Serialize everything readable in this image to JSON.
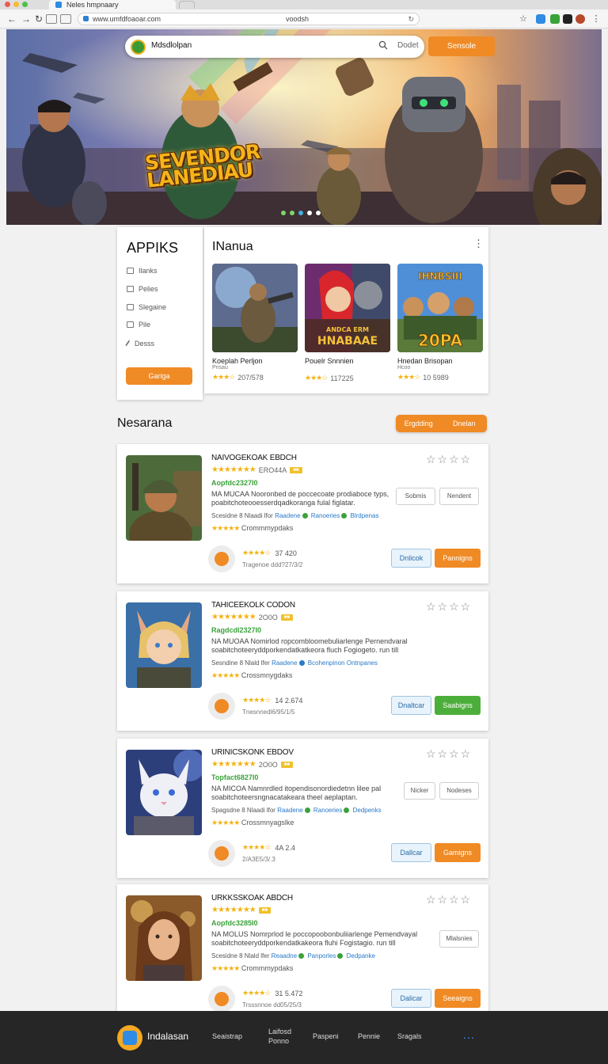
{
  "browser": {
    "tab_title": "Neles hmpnaary",
    "url": "www.umfdfoaoar.com",
    "url_mid": "voodsh",
    "traffic_colors": [
      "#ee5b52",
      "#f5bd2f",
      "#49c249"
    ]
  },
  "hero": {
    "site_name": "Mdsdlolpan",
    "search_placeholder": "Dodet",
    "cta_label": "Sensole",
    "title_line1": "SEVENDOR",
    "title_line2": "LANEDIAU",
    "active_slide": 4,
    "slide_count": 5
  },
  "sidebar": {
    "title": "APPIKS",
    "items": [
      {
        "label": "Ilanks",
        "icon": "tag-icon"
      },
      {
        "label": "Pelies",
        "icon": "image-icon"
      },
      {
        "label": "Slegaine",
        "icon": "box-icon"
      },
      {
        "label": "Pile",
        "icon": "folder-icon"
      },
      {
        "label": "Desss",
        "icon": "pencil-icon"
      }
    ],
    "button_label": "Gariga"
  },
  "featured": {
    "title": "INanua",
    "items": [
      {
        "name": "Koeplah Perljon",
        "sub": "Prisau",
        "stars": 3.5,
        "count": "207/578"
      },
      {
        "name": "Pouelr Snnnien",
        "sub": "",
        "stars": 3.5,
        "count": "117225"
      },
      {
        "name": "Hnedan Brisopan",
        "sub": "Hcoo",
        "stars": 3.5,
        "count": "10 5989"
      }
    ],
    "img_texts": [
      "",
      "ANDCA ERM\nHNABAAE",
      "IHNBSIII\n20PA"
    ]
  },
  "section": {
    "title": "Nesarana",
    "toggle_left": "Ergdding",
    "toggle_right": "Dnelan"
  },
  "apps": [
    {
      "title": "NAIVOGEKOAK EBDCH",
      "rating_text": "ERO44A",
      "price": "Aopfdc2327I0",
      "desc": "MA MUCAA Nooronbed de poccecoate prodiaboce typs, poabitchoteooesserdqadkoranga fulal figlatar.",
      "meta_prefix": "Scesidne 8 Nlaadi lfor",
      "meta_l1": "Raadene",
      "meta_l2": "Ranoeries",
      "meta_l3": "Blrdpenas",
      "reviews": "Crommmypdaks",
      "btn1": "Sobmis",
      "btn2": "Nendent",
      "foot_rating": "37 420",
      "foot_sub": "Tragenoe ddd?27/3/2",
      "action1": "Dnlicok",
      "action2": "Pannigns",
      "action2_color": "#f08a24"
    },
    {
      "title": "TAHICEEKOLK CODON",
      "rating_text": "2O0O",
      "price": "Ragdcdl2327I0",
      "desc": "NA MUOAA Nomirlod ropcombloomebuliarlenge Pernendvaral soabitchoteeryddporkendatkatkeora fluch Fogiogeto. run till",
      "meta_prefix": "Sesndine 8 Nlald lfer",
      "meta_l1": "Raadene",
      "meta_l2": "Bcohenpinon",
      "meta_l3": "Ontnpanes",
      "reviews": "Crossmnygdaks",
      "btn1": "",
      "btn2": "",
      "foot_rating": "14 2.674",
      "foot_sub": "Tnesnnedl6/95/1/5",
      "action1": "Dnaltcar",
      "action2": "Saabigns",
      "action2_color": "#4cae3a"
    },
    {
      "title": "URINICSKONK EBDOV",
      "rating_text": "2O0O",
      "price": "Topfact6827I0",
      "desc": "NA MICOA Namnrdled itopendisonordiedetnn lilee pal soabitchoteersngnacatakeara theel aeplaptan.",
      "meta_prefix": "Spagsdne 8 Nlaadi lfor",
      "meta_l1": "Raadene",
      "meta_l2": "Ranoeries",
      "meta_l3": "Dedpenks",
      "reviews": "Crossmnyagslke",
      "btn1": "Nicker",
      "btn2": "Nodeses",
      "foot_rating": "4A 2.4",
      "foot_sub": "2/A3E5/3/.3",
      "action1": "Dallcar",
      "action2": "Gamigns",
      "action2_color": "#f08a24"
    },
    {
      "title": "URKKSSKOAK ABDCH",
      "rating_text": "",
      "price": "Aopfdc3285I0",
      "desc": "NA MOLUS Nomrprlod le poccopoobonbuliiarlenge Pemendvayal soabitchoteeryddporkendatkakeora fluhi Fogistagio. run till",
      "meta_prefix": "Scesidne 8 Nlald lfer",
      "meta_l1": "Reaadne",
      "meta_l2": "Panporles",
      "meta_l3": "Dedpanke",
      "reviews": "Crommmypdaks",
      "btn1": "",
      "btn2": "Mlalsnies",
      "foot_rating": "31 5.472",
      "foot_sub": "Trsssnnoe dd05/25/3",
      "action1": "Dalicar",
      "action2": "Seeaigns",
      "action2_color": "#f08a24"
    }
  ],
  "footer": {
    "brand": "Indalasan",
    "links": [
      "Seaistrap",
      "Laifosd Ponno",
      "Paspeni",
      "Pennie",
      "Sragals"
    ],
    "more": "…"
  }
}
